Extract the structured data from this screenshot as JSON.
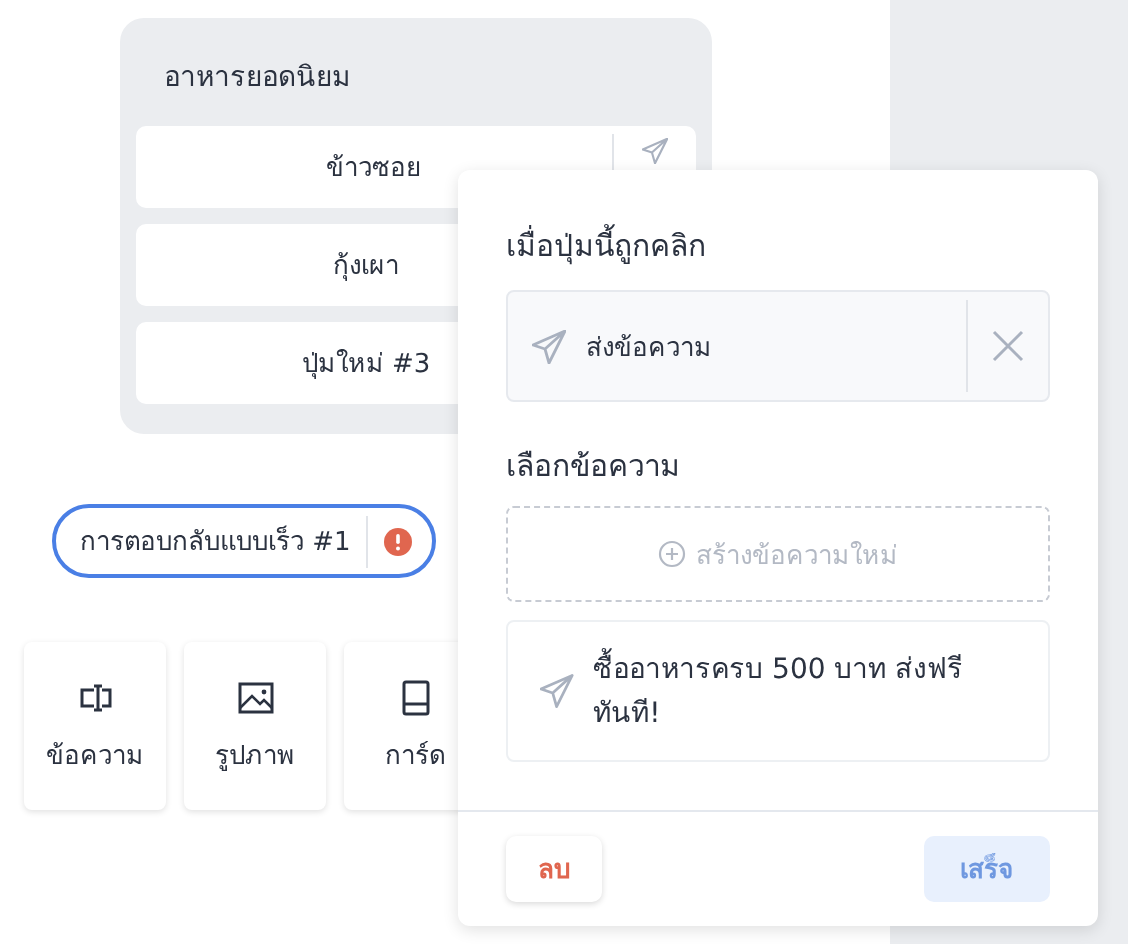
{
  "menu_card": {
    "title": "อาหารยอดนิยม",
    "buttons": [
      {
        "label": "ข้าวซอย",
        "kind": "action"
      },
      {
        "label": "กุ้งเผา",
        "kind": "plain"
      },
      {
        "label": "ปุ่มใหม่ #3",
        "kind": "plain"
      }
    ]
  },
  "quick_reply": {
    "label": "การตอบกลับแบบเร็ว #1",
    "selected": true,
    "error": true
  },
  "tiles": [
    {
      "label": "ข้อความ",
      "kind": "text"
    },
    {
      "label": "รูปภาพ",
      "kind": "image"
    },
    {
      "label": "การ์ด",
      "kind": "card"
    }
  ],
  "popover": {
    "title": "เมื่อปุ่มนี้ถูกคลิก",
    "action": {
      "label": "ส่งข้อความ"
    },
    "section_title": "เลือกข้อความ",
    "create_label": "สร้างข้อความใหม่",
    "messages": [
      {
        "text": "ซื้ออาหารครบ 500 บาท ส่งฟรีทันที!"
      }
    ],
    "buttons": [
      {
        "label": "ลบ",
        "kind": "danger",
        "disabled": false
      },
      {
        "label": "เสร็จ",
        "kind": "primary",
        "disabled": true
      }
    ]
  }
}
